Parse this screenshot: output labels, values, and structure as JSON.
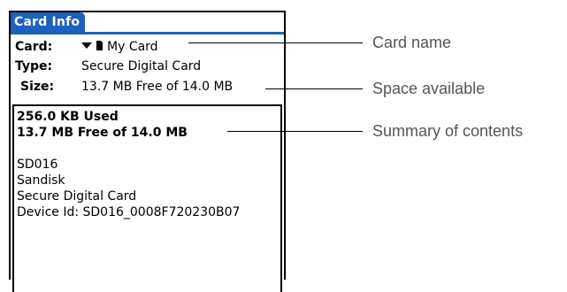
{
  "window": {
    "title": "Card Info"
  },
  "fields": {
    "card_label": "Card:",
    "card_value": "My Card",
    "type_label": "Type:",
    "type_value": "Secure Digital Card",
    "size_label": "Size:",
    "size_value": "13.7 MB Free of 14.0 MB"
  },
  "contents": {
    "used": "256.0 KB Used",
    "free": "13.7 MB Free of 14.0 MB",
    "lines": [
      "SD016",
      "Sandisk",
      "Secure Digital Card",
      "Device Id: SD016_0008F720230B07"
    ]
  },
  "callouts": {
    "card_name": "Card name",
    "space_available": "Space available",
    "summary": "Summary of contents"
  },
  "colors": {
    "title_bar": "#1f5fbf",
    "callout_text": "#555555"
  },
  "icons": {
    "dropdown": "triangle-down-icon",
    "card": "sd-card-icon"
  }
}
